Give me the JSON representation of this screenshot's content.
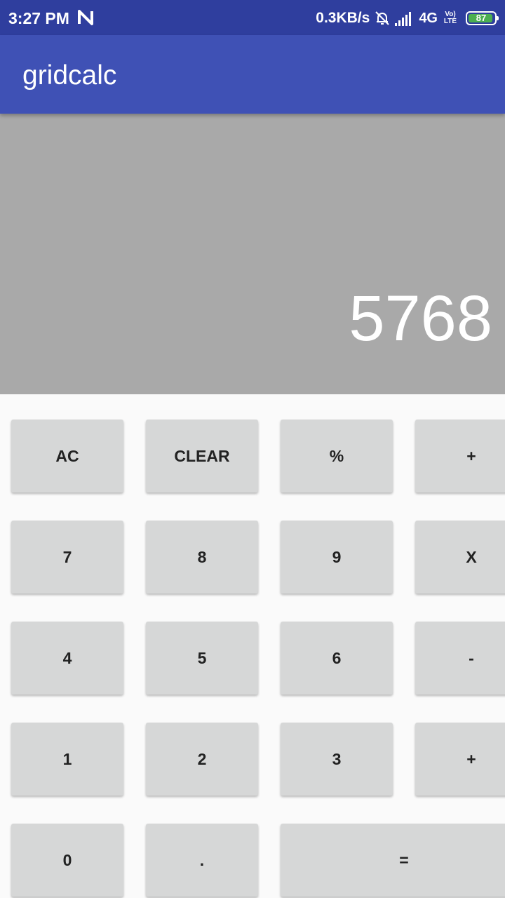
{
  "status_bar": {
    "time": "3:27 PM",
    "net_speed": "0.3KB/s",
    "network_type": "4G",
    "volte_top": "Vo)",
    "volte_bottom": "LTE",
    "battery_level": "87",
    "battery_color": "#4caf50",
    "icons": [
      "n-notification-icon",
      "alarm-off-icon",
      "signal-strength-icon",
      "battery-icon"
    ]
  },
  "app_bar": {
    "title": "gridcalc",
    "color": "#3f51b5"
  },
  "display": {
    "value": "5768",
    "background": "#a9a9a9"
  },
  "keys": {
    "ac": "AC",
    "clear": "CLEAR",
    "percent": "%",
    "add_top": "+",
    "seven": "7",
    "eight": "8",
    "nine": "9",
    "multiply": "X",
    "four": "4",
    "five": "5",
    "six": "6",
    "subtract": "-",
    "one": "1",
    "two": "2",
    "three": "3",
    "add": "+",
    "zero": "0",
    "decimal": ".",
    "equals": "="
  }
}
